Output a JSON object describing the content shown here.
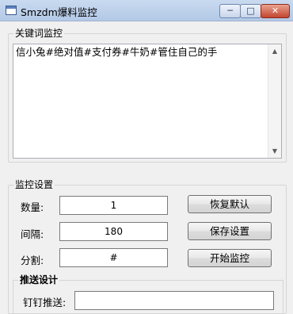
{
  "window": {
    "title": "Smzdm爆料监控",
    "min_label": "─",
    "max_label": "□",
    "close_label": "✕"
  },
  "keyword_section": {
    "label": "关键词监控",
    "content": "信小兔#绝对值#支付券#牛奶#管住自己的手",
    "scroll_up": "▲",
    "scroll_down": "▼"
  },
  "monitor_section": {
    "label": "监控设置",
    "quantity_label": "数量:",
    "quantity_value": "1",
    "interval_label": "间隔:",
    "interval_value": "180",
    "separator_label": "分割:",
    "separator_value": "#",
    "reset_button": "恢复默认",
    "save_button": "保存设置",
    "start_button": "开始监控"
  },
  "push_section": {
    "label": "推送设计",
    "dingtalk_label": "钉钉推送:",
    "dingtalk_value": ""
  }
}
